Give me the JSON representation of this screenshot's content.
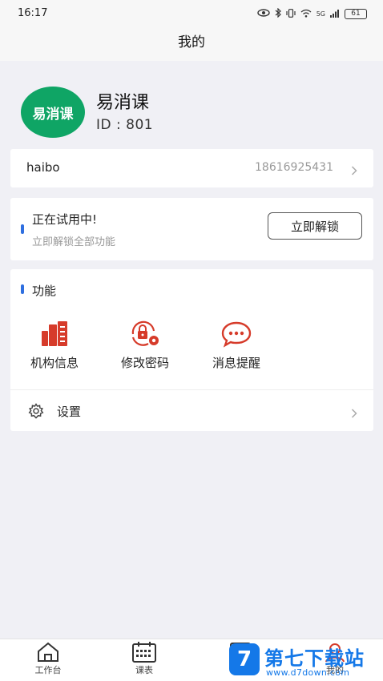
{
  "status_bar": {
    "time": "16:17",
    "network": "5G",
    "battery": "61"
  },
  "header": {
    "title": "我的"
  },
  "profile": {
    "logo_text": "易消课",
    "name": "易消课",
    "id": "ID : 801"
  },
  "account": {
    "username": "haibo",
    "phone": "18616925431"
  },
  "trial": {
    "title": "正在试用中!",
    "subtitle": "立即解锁全部功能",
    "button_label": "立即解锁"
  },
  "functions": {
    "title": "功能",
    "items": [
      {
        "label": "机构信息",
        "icon": "building-icon"
      },
      {
        "label": "修改密码",
        "icon": "lock-gear-icon"
      },
      {
        "label": "消息提醒",
        "icon": "chat-bubble-icon"
      }
    ],
    "settings_label": "设置"
  },
  "tab_bar": {
    "items": [
      {
        "label": "工作台",
        "icon": "home-icon"
      },
      {
        "label": "课表",
        "icon": "calendar-icon"
      },
      {
        "label": "",
        "icon": "checklist-icon"
      },
      {
        "label": "我的",
        "icon": "user-icon"
      }
    ]
  },
  "watermark": {
    "logo_text": "7",
    "title": "第七下载站",
    "url": "www.d7down.com"
  },
  "colors": {
    "accent": "#2f6fe0",
    "icon_red": "#d63b2a",
    "logo_green": "#0fa565",
    "watermark_blue": "#1478e8"
  }
}
